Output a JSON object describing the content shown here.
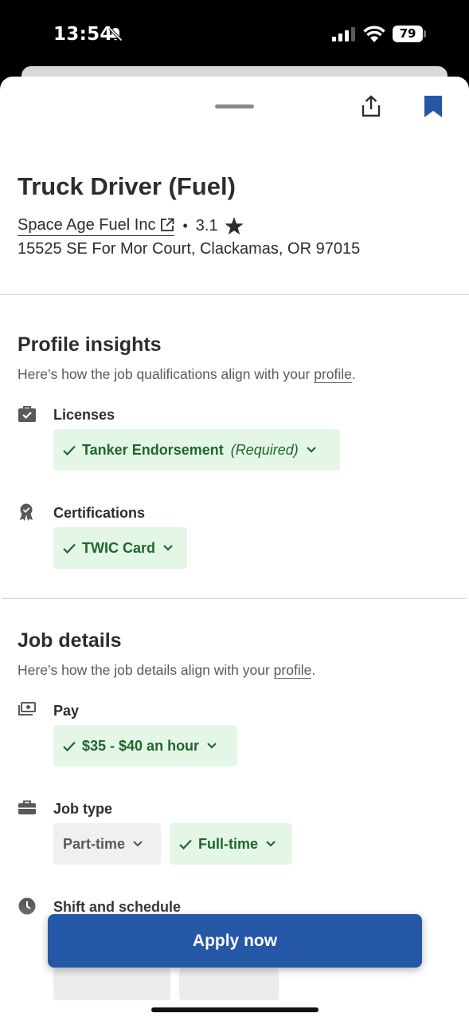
{
  "status_bar": {
    "time": "13:54",
    "battery": "79",
    "icons": [
      "bell-slash-icon",
      "signal-icon",
      "wifi-icon",
      "battery-icon"
    ]
  },
  "header": {
    "icons": [
      "share-icon",
      "bookmark-icon"
    ],
    "bookmark_color": "#2557a7"
  },
  "job": {
    "title": "Truck Driver (Fuel)",
    "company": "Space Age Fuel Inc",
    "separator": "•",
    "rating": "3.1",
    "address": "15525 SE For Mor Court, Clackamas, OR 97015"
  },
  "profile_insights": {
    "title": "Profile insights",
    "subtitle_prefix": "Here’s how the job qualifications align with your ",
    "subtitle_link": "profile",
    "subtitle_suffix": ".",
    "licenses": {
      "label": "Licenses",
      "chips": [
        {
          "text": "Tanker Endorsement",
          "note": "(Required)",
          "matched": true
        }
      ]
    },
    "certifications": {
      "label": "Certifications",
      "chips": [
        {
          "text": "TWIC Card",
          "matched": true
        }
      ]
    }
  },
  "job_details": {
    "title": "Job details",
    "subtitle_prefix": "Here’s how the job details align with your ",
    "subtitle_link": "profile",
    "subtitle_suffix": ".",
    "pay": {
      "label": "Pay",
      "chips": [
        {
          "text": "$35 - $40 an hour",
          "matched": true
        }
      ]
    },
    "job_type": {
      "label": "Job type",
      "chips": [
        {
          "text": "Part-time",
          "matched": false
        },
        {
          "text": "Full-time",
          "matched": true
        }
      ]
    },
    "shift": {
      "label": "Shift and schedule"
    }
  },
  "apply_button": {
    "label": "Apply now",
    "color": "#2557a7"
  },
  "colors": {
    "match_bg": "#e4f7e6",
    "match_text": "#1f662c",
    "neutral_bg": "#f0f0f0"
  }
}
